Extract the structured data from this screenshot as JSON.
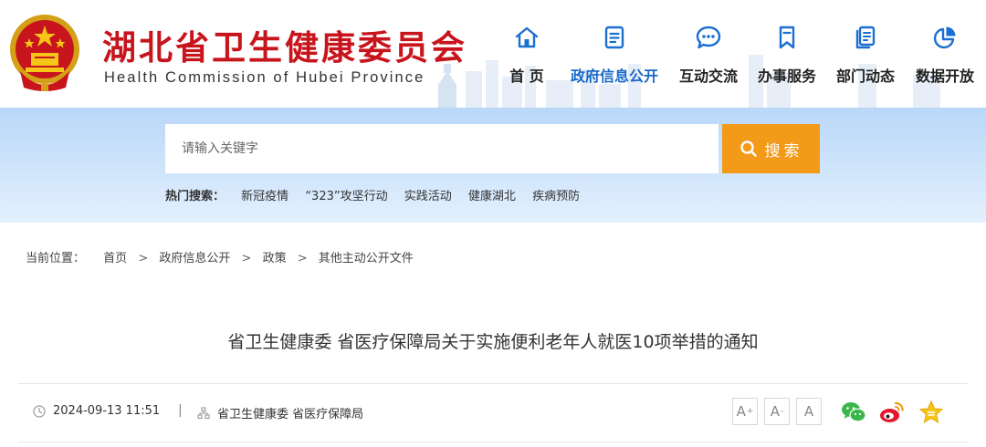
{
  "header": {
    "title_cn": "湖北省卫生健康委员会",
    "title_en": "Health Commission of Hubei Province",
    "emblem_icon": "national-emblem-icon"
  },
  "nav": {
    "items": [
      {
        "label": "首  页",
        "icon": "home-icon"
      },
      {
        "label": "政府信息公开",
        "icon": "document-list-icon",
        "active": true
      },
      {
        "label": "互动交流",
        "icon": "chat-bubble-icon"
      },
      {
        "label": "办事服务",
        "icon": "bookmark-icon"
      },
      {
        "label": "部门动态",
        "icon": "news-pages-icon"
      },
      {
        "label": "数据开放",
        "icon": "pie-chart-icon"
      }
    ],
    "active_color": "#1869c9",
    "icon_color": "#1b6fd1"
  },
  "search": {
    "placeholder": "请输入关键字",
    "button_label": "搜索",
    "button_color": "#f39a18",
    "hot_label": "热门搜索：",
    "hot_links": [
      "新冠疫情",
      "“323”攻坚行动",
      "实践活动",
      "健康湖北",
      "疾病预防"
    ]
  },
  "breadcrumb": {
    "lead": "当前位置：",
    "items": [
      "首页",
      "政府信息公开",
      "政策",
      "其他主动公开文件"
    ],
    "separator": ">"
  },
  "article": {
    "title": "省卫生健康委 省医疗保障局关于实施便利老年人就医10项举措的通知",
    "date": "2024-09-13 11:51",
    "meta_separator": "|",
    "source": "省卫生健康委 省医疗保障局"
  },
  "tools": {
    "font_sizes": [
      "A+",
      "A-",
      "A"
    ],
    "share": [
      "wechat-icon",
      "weibo-icon",
      "favorite-star-icon"
    ]
  },
  "colors": {
    "brand_red": "#c8151d",
    "accent_orange": "#f39a18"
  }
}
